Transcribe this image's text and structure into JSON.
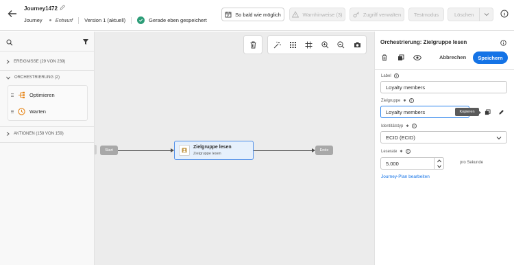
{
  "header": {
    "journey_name": "Journey1472",
    "journey_label": "Journey",
    "status": "Entwurf",
    "version": "Version 1 (aktuell)",
    "saved_text": "Gerade eben gespeichert",
    "schedule_label": "So bald wie möglich",
    "warnings_label": "Warnhinweise (3)",
    "access_label": "Zugriff verwalten",
    "testmode_label": "Testmodus",
    "delete_label": "Löschen"
  },
  "sidebar": {
    "events": "EREIGNISSE (29 VON 239)",
    "orchestration": "ORCHESTRIERUNG (2)",
    "items": [
      {
        "label": "Optimieren",
        "icon": "optimize-icon"
      },
      {
        "label": "Warten",
        "icon": "clock-icon"
      }
    ],
    "actions": "AKTIONEN (158 VON 159)"
  },
  "canvas": {
    "start_label": "Start",
    "end_label": "Ende",
    "node_title": "Zielgruppe lesen",
    "node_subtitle": "Zielgruppe lesen"
  },
  "panel": {
    "title": "Orchestrierung: Zielgruppe lesen",
    "cancel_label": "Abbrechen",
    "save_label": "Speichern",
    "label_label": "Label",
    "label_value": "Loyalty members",
    "audience_label": "Zielgruppe",
    "audience_value": "Loyalty members",
    "copy_tooltip": "Kopieren",
    "identity_label": "Identitätstyp",
    "identity_value": "ECID (ECID)",
    "rate_label": "Leserate",
    "rate_value": "5.000",
    "rate_unit": "pro Sekunde",
    "edit_plan_link": "Journey-Plan bearbeiten"
  },
  "colors": {
    "accent": "#1473e6",
    "node_border": "#4b8ce8",
    "saved_green": "#2d9d78",
    "wait_orange": "#e68619"
  }
}
